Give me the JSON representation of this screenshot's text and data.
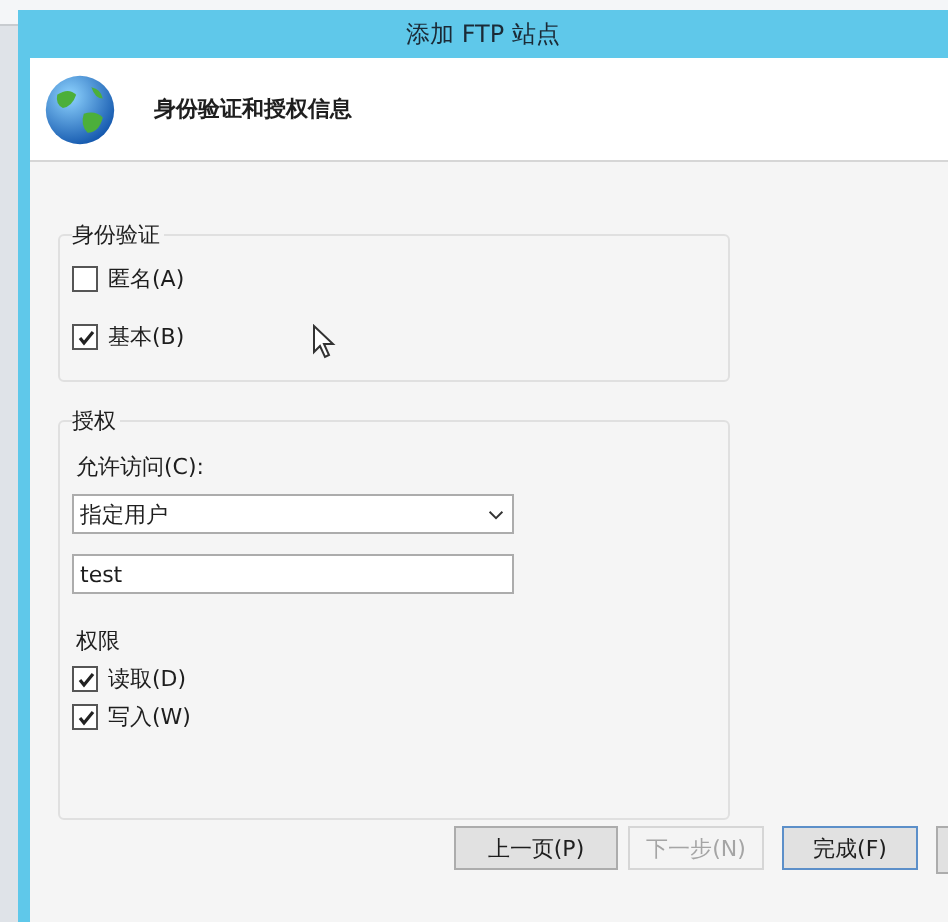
{
  "window": {
    "title": "添加 FTP 站点"
  },
  "header": {
    "title": "身份验证和授权信息"
  },
  "authentication": {
    "title": "身份验证",
    "options": [
      {
        "label": "匿名(A)",
        "checked": false
      },
      {
        "label": "基本(B)",
        "checked": true
      }
    ]
  },
  "authorization": {
    "title": "授权",
    "access_label": "允许访问(C):",
    "access_value": "指定用户",
    "user_value": "test",
    "permissions_title": "权限",
    "permissions": [
      {
        "label": "读取(D)",
        "checked": true
      },
      {
        "label": "写入(W)",
        "checked": true
      }
    ]
  },
  "buttons": [
    {
      "label": "上一页(P)",
      "disabled": false
    },
    {
      "label": "下一步(N)",
      "disabled": true
    },
    {
      "label": "完成(F)",
      "disabled": false
    }
  ]
}
